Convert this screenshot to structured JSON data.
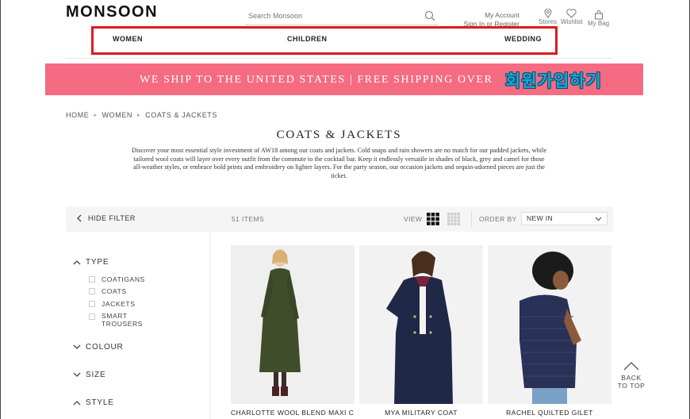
{
  "header": {
    "logo": "MONSOON",
    "search_placeholder": "Search Monsoon",
    "account_label": "My Account",
    "account_sub": "Sign In or Register",
    "stores_label": "Stores",
    "wishlist_label": "Wishlist",
    "bag_label": "My Bag"
  },
  "nav": {
    "women": "WOMEN",
    "children": "CHILDREN",
    "wedding": "WEDDING"
  },
  "banner": {
    "text": "WE SHIP TO THE UNITED STATES | FREE SHIPPING OVER",
    "overlay": "회원가입하기",
    "bg_color": "#f56b82"
  },
  "breadcrumb": [
    "HOME",
    "WOMEN",
    "COATS & JACKETS"
  ],
  "page": {
    "title": "COATS & JACKETS",
    "description": "Discover your most essential style investment of AW18 among our coats and jackets. Cold snaps and rain showers are no match for our padded jackets, while tailored wool coats will layer over every outfit from the commute to the cocktail bar. Keep it endlessly versatile in shades of black, grey and camel for those all-weather styles, or embrace bold prints and embroidery on lighter layers. For the party season, our occasion jackets and sequin-adorned pieces are just the ticket."
  },
  "filter_bar": {
    "hide_filter": "HIDE FILTER",
    "items_count": "51 ITEMS",
    "view_label": "VIEW",
    "order_label": "ORDER BY",
    "order_value": "NEW IN"
  },
  "sidebar": {
    "type_label": "TYPE",
    "type_options": [
      "COATIGANS",
      "COATS",
      "JACKETS",
      "SMART TROUSERS"
    ],
    "colour_label": "COLOUR",
    "size_label": "SIZE",
    "style_label": "STYLE"
  },
  "products": [
    {
      "name": "CHARLOTTE WOOL BLEND MAXI C..."
    },
    {
      "name": "MYA MILITARY COAT"
    },
    {
      "name": "RACHEL QUILTED GILET"
    }
  ],
  "back_to_top": {
    "line1": "BACK",
    "line2": "TO TOP"
  }
}
